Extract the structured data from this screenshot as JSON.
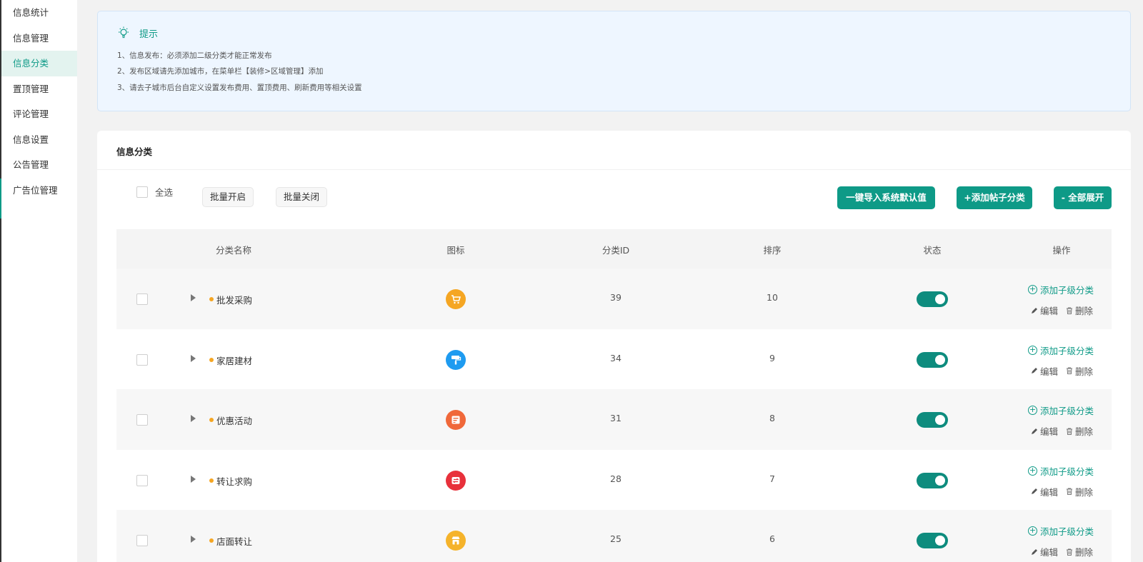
{
  "sidebar": {
    "items": [
      {
        "label": "信息统计",
        "active": false
      },
      {
        "label": "信息管理",
        "active": false
      },
      {
        "label": "信息分类",
        "active": true
      },
      {
        "label": "置顶管理",
        "active": false
      },
      {
        "label": "评论管理",
        "active": false
      },
      {
        "label": "信息设置",
        "active": false
      },
      {
        "label": "公告管理",
        "active": false
      },
      {
        "label": "广告位管理",
        "active": false
      }
    ]
  },
  "tips": {
    "title": "提示",
    "lines": [
      "1、信息发布：必须添加二级分类才能正常发布",
      "2、发布区域请先添加城市，在菜单栏【装修>区域管理】添加",
      "3、请去子城市后台自定义设置发布费用、置顶费用、刷新费用等相关设置"
    ]
  },
  "panel": {
    "title": "信息分类",
    "select_all": "全选",
    "batch_on": "批量开启",
    "batch_off": "批量关闭",
    "import_default": "一键导入系统默认值",
    "add_category": "+添加帖子分类",
    "expand_all": "- 全部展开"
  },
  "table": {
    "headers": [
      "分类名称",
      "图标",
      "分类ID",
      "排序",
      "状态",
      "操作"
    ],
    "add_child_label": "添加子级分类",
    "edit_label": "编辑",
    "delete_label": "删除",
    "rows": [
      {
        "name": "批发采购",
        "icon": "cart-icon",
        "icon_color": "#f5a623",
        "id": "39",
        "sort": "10",
        "enabled": true
      },
      {
        "name": "家居建材",
        "icon": "paint-roller-icon",
        "icon_color": "#1e9bf0",
        "id": "34",
        "sort": "9",
        "enabled": true
      },
      {
        "name": "优惠活动",
        "icon": "coupon-icon",
        "icon_color": "#f0683a",
        "id": "31",
        "sort": "8",
        "enabled": true
      },
      {
        "name": "转让求购",
        "icon": "transfer-icon",
        "icon_color": "#e8313b",
        "id": "28",
        "sort": "7",
        "enabled": true
      },
      {
        "name": "店面转让",
        "icon": "shop-icon",
        "icon_color": "#f5b32b",
        "id": "25",
        "sort": "6",
        "enabled": true
      }
    ]
  },
  "colors": {
    "accent": "#0e9a87",
    "toggle_on": "#0e8c7e"
  }
}
